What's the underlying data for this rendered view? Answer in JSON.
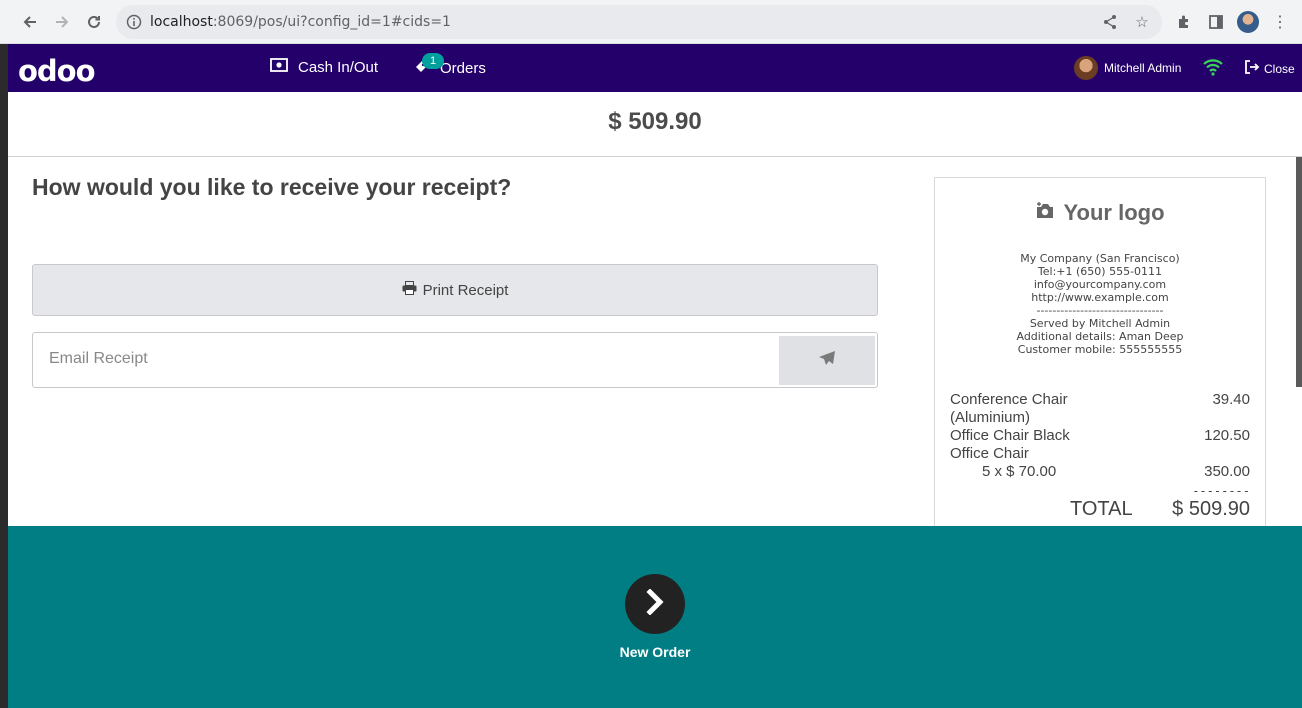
{
  "browser": {
    "url_host": "localhost",
    "url_rest": ":8069/pos/ui?config_id=1#cids=1"
  },
  "navbar": {
    "logo": "odoo",
    "cash_label": "Cash In/Out",
    "orders_label": "Orders",
    "orders_badge": "1",
    "user_name": "Mitchell Admin",
    "close_label": "Close"
  },
  "order": {
    "total": "$ 509.90"
  },
  "receipt_screen": {
    "question": "How would you like to receive your receipt?",
    "print_label": "Print Receipt",
    "email_placeholder": "Email Receipt"
  },
  "receipt": {
    "logo_text": "Your logo",
    "info_lines": [
      "My Company (San Francisco)",
      "Tel:+1 (650) 555-0111",
      "info@yourcompany.com",
      "http://www.example.com",
      "--------------------------------",
      "Served by Mitchell Admin",
      "Additional details: Aman Deep",
      "Customer mobile: 555555555"
    ],
    "lines": [
      {
        "name": "Conference Chair",
        "price": "39.40"
      },
      {
        "name": "(Aluminium)",
        "price": ""
      },
      {
        "name": "Office Chair Black",
        "price": "120.50"
      },
      {
        "name": "Office Chair",
        "price": ""
      },
      {
        "name": "5 x $ 70.00",
        "price": "350.00"
      }
    ],
    "separator": "--------",
    "total_label": "TOTAL",
    "total_value": "$ 509.90"
  },
  "footer": {
    "next_label": "New Order"
  },
  "colors": {
    "navbar": "#24006a",
    "footer": "#017e84",
    "badge": "#00a09d"
  }
}
